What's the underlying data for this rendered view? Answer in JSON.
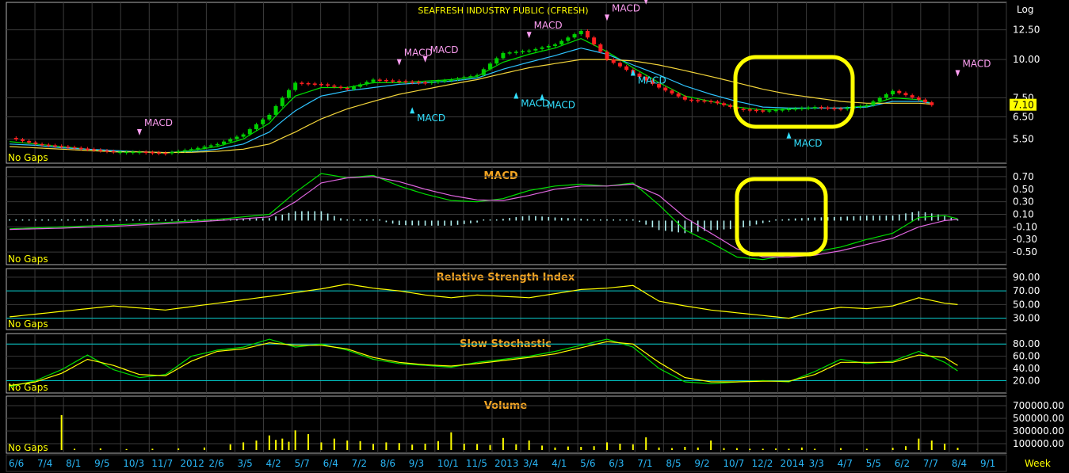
{
  "header": {
    "title": "SEAFRESH INDUSTRY PUBLIC (CFRESH)",
    "scale_label": "Log",
    "timeframe": "Week"
  },
  "no_gaps_label": "No Gaps",
  "colors": {
    "background": "#000000",
    "panel_border": "#b0b0b0",
    "grid": "#3a3a3a",
    "axis_text": "#ffffff",
    "date_text": "#29b6f6",
    "title_text": "#f5a623",
    "highlight": "#ffff00",
    "up_candle": "#00d000",
    "down_candle": "#ff2020",
    "macd_line": "#00dd00",
    "signal_line": "#e066e0",
    "histogram": "#b0f0f0",
    "rsi_line": "#ffff00",
    "stoch_k": "#00dd00",
    "stoch_d": "#ffff00",
    "volume_bar": "#ffff00",
    "ref_line": "#00c8c8"
  },
  "x_axis": {
    "labels": [
      "6/6",
      "7/4",
      "8/1",
      "9/5",
      "10/3",
      "11/7",
      "2012",
      "2/6",
      "3/5",
      "4/2",
      "5/7",
      "6/4",
      "7/2",
      "8/6",
      "9/3",
      "10/1",
      "11/5",
      "2013",
      "3/4",
      "4/1",
      "5/6",
      "6/3",
      "7/1",
      "8/5",
      "9/2",
      "10/7",
      "12/2",
      "2014",
      "3/3",
      "4/7",
      "5/5",
      "6/2",
      "7/7",
      "8/4",
      "9/1"
    ]
  },
  "chart_data": [
    {
      "type": "line",
      "title": "SEAFRESH INDUSTRY PUBLIC (CFRESH)",
      "scale": "log",
      "last_price": "7.10",
      "y_ticks": [
        "12.50",
        "10.00",
        "7.50",
        "6.50",
        "5.50"
      ],
      "ylim": [
        4.7,
        15.0
      ],
      "x_index": [
        0,
        4,
        8,
        12,
        16,
        20,
        24,
        28,
        32,
        36,
        40,
        44,
        48,
        52,
        56,
        60,
        64,
        68,
        72,
        76,
        80,
        84,
        88,
        92,
        96,
        100,
        104,
        108,
        112,
        116,
        120,
        124,
        128,
        132,
        136,
        140,
        142
      ],
      "series": [
        {
          "name": "close",
          "values": [
            5.55,
            5.3,
            5.2,
            5.1,
            5.0,
            5.0,
            4.95,
            5.1,
            5.3,
            5.7,
            6.6,
            8.4,
            8.3,
            8.0,
            8.6,
            8.5,
            8.4,
            8.6,
            8.9,
            10.5,
            10.7,
            11.2,
            12.4,
            10.0,
            9.0,
            8.1,
            7.4,
            7.3,
            6.9,
            6.8,
            6.9,
            7.0,
            6.9,
            7.1,
            7.9,
            7.4,
            7.1
          ]
        },
        {
          "name": "ema_short",
          "values": [
            5.4,
            5.3,
            5.2,
            5.1,
            5.0,
            5.0,
            4.95,
            5.05,
            5.2,
            5.5,
            6.2,
            7.6,
            8.1,
            8.1,
            8.4,
            8.4,
            8.5,
            8.6,
            8.8,
            9.8,
            10.4,
            10.9,
            11.7,
            10.6,
            9.4,
            8.4,
            7.6,
            7.3,
            7.0,
            6.85,
            6.9,
            6.95,
            6.95,
            7.05,
            7.5,
            7.4,
            7.2
          ]
        },
        {
          "name": "ema_mid",
          "values": [
            5.3,
            5.25,
            5.15,
            5.1,
            5.05,
            5.0,
            4.97,
            5.0,
            5.1,
            5.3,
            5.8,
            6.8,
            7.6,
            7.9,
            8.1,
            8.3,
            8.4,
            8.5,
            8.7,
            9.3,
            9.8,
            10.3,
            10.9,
            10.4,
            9.6,
            8.9,
            8.2,
            7.7,
            7.3,
            7.0,
            6.95,
            6.95,
            6.95,
            7.0,
            7.3,
            7.3,
            7.2
          ]
        },
        {
          "name": "ema_long",
          "values": [
            5.2,
            5.15,
            5.1,
            5.05,
            5.0,
            5.0,
            4.97,
            4.98,
            5.02,
            5.1,
            5.3,
            5.8,
            6.4,
            6.9,
            7.3,
            7.7,
            8.0,
            8.3,
            8.6,
            9.0,
            9.4,
            9.7,
            10.0,
            10.0,
            9.9,
            9.6,
            9.2,
            8.8,
            8.4,
            8.0,
            7.7,
            7.5,
            7.3,
            7.2,
            7.2,
            7.2,
            7.15
          ]
        }
      ],
      "annotations": [
        {
          "label": "MACD",
          "dir": "sell",
          "x": 20,
          "price": 5.2
        },
        {
          "label": "MACD",
          "dir": "sell",
          "x": 60,
          "price": 8.8
        },
        {
          "label": "MACD",
          "dir": "sell",
          "x": 64,
          "price": 9.0
        },
        {
          "label": "MACD",
          "dir": "buy",
          "x": 62,
          "price": 7.6
        },
        {
          "label": "MACD",
          "dir": "sell",
          "x": 80,
          "price": 10.8
        },
        {
          "label": "MACD",
          "dir": "buy",
          "x": 78,
          "price": 8.5
        },
        {
          "label": "MACD",
          "dir": "buy",
          "x": 82,
          "price": 8.4
        },
        {
          "label": "MACD",
          "dir": "sell",
          "x": 92,
          "price": 12.3
        },
        {
          "label": "MACD",
          "dir": "sell",
          "x": 98,
          "price": 13.9
        },
        {
          "label": "MACD",
          "dir": "buy",
          "x": 96,
          "price": 10.1
        },
        {
          "label": "MACD",
          "dir": "buy",
          "x": 120,
          "price": 6.3
        },
        {
          "label": "MACD",
          "dir": "sell",
          "x": 146,
          "price": 8.1
        }
      ]
    },
    {
      "type": "line",
      "title": "MACD",
      "y_ticks": [
        "0.70",
        "0.50",
        "0.30",
        "0.10",
        "-0.10",
        "-0.30",
        "-0.50"
      ],
      "ylim": [
        -0.65,
        0.8
      ],
      "x_index": [
        0,
        8,
        16,
        24,
        32,
        40,
        44,
        48,
        52,
        56,
        60,
        64,
        68,
        72,
        76,
        80,
        84,
        88,
        92,
        96,
        100,
        104,
        108,
        112,
        116,
        120,
        124,
        128,
        132,
        136,
        140,
        144,
        146
      ],
      "series": [
        {
          "name": "MACD",
          "values": [
            -0.13,
            -0.1,
            -0.07,
            -0.03,
            0.02,
            0.1,
            0.45,
            0.75,
            0.68,
            0.72,
            0.55,
            0.42,
            0.32,
            0.3,
            0.35,
            0.48,
            0.55,
            0.58,
            0.55,
            0.6,
            0.25,
            -0.15,
            -0.35,
            -0.58,
            -0.62,
            -0.55,
            -0.5,
            -0.42,
            -0.3,
            -0.2,
            0.05,
            0.08,
            0.03
          ]
        },
        {
          "name": "Signal",
          "values": [
            -0.14,
            -0.12,
            -0.09,
            -0.05,
            0.0,
            0.06,
            0.3,
            0.6,
            0.68,
            0.7,
            0.62,
            0.5,
            0.4,
            0.33,
            0.32,
            0.4,
            0.5,
            0.55,
            0.55,
            0.58,
            0.4,
            0.05,
            -0.2,
            -0.45,
            -0.58,
            -0.58,
            -0.55,
            -0.48,
            -0.38,
            -0.28,
            -0.1,
            0.0,
            0.02
          ]
        },
        {
          "name": "Histogram",
          "values": [
            0.01,
            0.02,
            0.02,
            0.02,
            0.02,
            0.04,
            0.15,
            0.15,
            0.0,
            0.02,
            -0.07,
            -0.08,
            -0.08,
            -0.03,
            0.03,
            0.08,
            0.05,
            0.03,
            0.0,
            0.02,
            -0.15,
            -0.2,
            -0.15,
            -0.13,
            -0.04,
            0.03,
            0.05,
            0.06,
            0.08,
            0.08,
            0.15,
            0.08,
            0.01
          ]
        }
      ]
    },
    {
      "type": "line",
      "title": "Relative Strength Index",
      "y_ticks": [
        "90.00",
        "70.00",
        "50.00",
        "30.00"
      ],
      "ylim": [
        18,
        98
      ],
      "reference_lines": [
        70,
        30
      ],
      "x_index": [
        0,
        8,
        16,
        24,
        32,
        40,
        48,
        52,
        56,
        60,
        64,
        68,
        72,
        76,
        80,
        84,
        88,
        92,
        96,
        100,
        104,
        108,
        112,
        116,
        120,
        124,
        128,
        132,
        136,
        140,
        144,
        146
      ],
      "series": [
        {
          "name": "RSI",
          "values": [
            32,
            40,
            48,
            42,
            52,
            62,
            73,
            80,
            74,
            70,
            64,
            60,
            64,
            62,
            60,
            66,
            72,
            74,
            78,
            55,
            48,
            42,
            38,
            34,
            30,
            40,
            46,
            44,
            48,
            60,
            52,
            50
          ]
        }
      ]
    },
    {
      "type": "line",
      "title": "Slow Stochastic",
      "y_ticks": [
        "80.00",
        "60.00",
        "40.00",
        "20.00"
      ],
      "ylim": [
        5,
        92
      ],
      "reference_lines": [
        80,
        20
      ],
      "x_index": [
        0,
        4,
        8,
        12,
        16,
        20,
        24,
        28,
        32,
        36,
        40,
        44,
        48,
        52,
        56,
        60,
        64,
        68,
        72,
        76,
        80,
        84,
        88,
        92,
        96,
        100,
        104,
        108,
        112,
        116,
        120,
        124,
        128,
        132,
        136,
        140,
        144,
        146
      ],
      "series": [
        {
          "name": "%K",
          "values": [
            10,
            20,
            38,
            62,
            38,
            25,
            30,
            60,
            70,
            75,
            88,
            75,
            80,
            70,
            55,
            48,
            45,
            42,
            50,
            55,
            60,
            68,
            78,
            88,
            75,
            40,
            18,
            15,
            18,
            20,
            18,
            35,
            55,
            48,
            52,
            68,
            50,
            36
          ]
        },
        {
          "name": "%D",
          "values": [
            12,
            18,
            32,
            55,
            45,
            30,
            28,
            52,
            68,
            72,
            82,
            78,
            78,
            72,
            58,
            50,
            46,
            44,
            48,
            53,
            58,
            64,
            74,
            84,
            80,
            50,
            25,
            18,
            18,
            19,
            19,
            30,
            50,
            50,
            50,
            62,
            58,
            45
          ]
        }
      ]
    },
    {
      "type": "bar",
      "title": "Volume",
      "y_ticks": [
        "700000.00",
        "500000.00",
        "300000.00",
        "100000.00"
      ],
      "ylim": [
        0,
        800000
      ],
      "x_index": [
        8,
        10,
        14,
        18,
        22,
        26,
        30,
        34,
        36,
        38,
        40,
        41,
        42,
        43,
        44,
        46,
        48,
        50,
        52,
        54,
        56,
        58,
        60,
        62,
        64,
        66,
        68,
        70,
        72,
        74,
        76,
        78,
        80,
        82,
        84,
        86,
        88,
        90,
        92,
        94,
        96,
        98,
        100,
        102,
        104,
        106,
        108,
        110,
        112,
        114,
        116,
        118,
        120,
        122,
        124,
        128,
        132,
        136,
        138,
        140,
        142,
        144,
        146
      ],
      "values": [
        550000,
        20000,
        25000,
        15000,
        20000,
        25000,
        40000,
        90000,
        120000,
        150000,
        230000,
        160000,
        180000,
        130000,
        310000,
        250000,
        120000,
        180000,
        150000,
        140000,
        95000,
        120000,
        110000,
        85000,
        100000,
        140000,
        280000,
        100000,
        95000,
        80000,
        190000,
        90000,
        150000,
        70000,
        40000,
        55000,
        50000,
        60000,
        120000,
        100000,
        90000,
        200000,
        40000,
        30000,
        50000,
        40000,
        150000,
        30000,
        30000,
        20000,
        20000,
        25000,
        20000,
        40000,
        20000,
        30000,
        20000,
        35000,
        60000,
        180000,
        150000,
        100000,
        35000
      ]
    }
  ]
}
